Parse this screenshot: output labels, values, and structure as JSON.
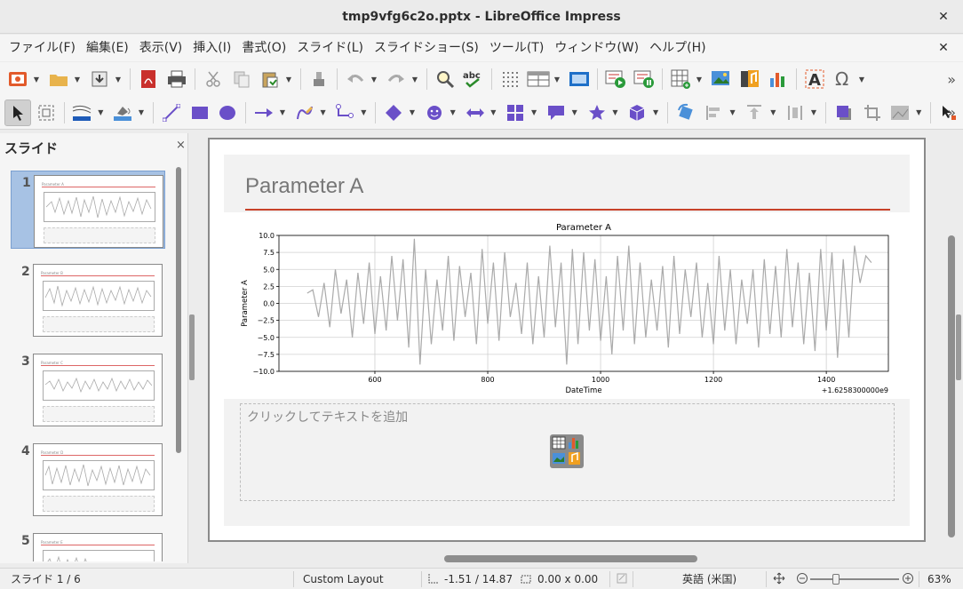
{
  "window": {
    "title": "tmp9vfg6c2o.pptx - LibreOffice Impress"
  },
  "menu": [
    "ファイル(F)",
    "編集(E)",
    "表示(V)",
    "挿入(I)",
    "書式(O)",
    "スライド(L)",
    "スライドショー(S)",
    "ツール(T)",
    "ウィンドウ(W)",
    "ヘルプ(H)"
  ],
  "slides_panel": {
    "title": "スライド",
    "close_label": "×",
    "thumbnails": [
      {
        "number": "1",
        "title": "Parameter A"
      },
      {
        "number": "2",
        "title": "Parameter B"
      },
      {
        "number": "3",
        "title": "Parameter C"
      },
      {
        "number": "4",
        "title": "Parameter D"
      },
      {
        "number": "5",
        "title": "Parameter E"
      }
    ]
  },
  "slide": {
    "title": "Parameter A",
    "text_placeholder": "クリックしてテキストを追加"
  },
  "chart_data": {
    "type": "line",
    "title": "Parameter A",
    "xlabel": "DateTime",
    "ylabel": "Parameter A",
    "offset_label": "+1.6258300000e9",
    "xlim": [
      430,
      1510
    ],
    "ylim": [
      -10.0,
      10.0
    ],
    "xticks": [
      600,
      800,
      1000,
      1200,
      1400
    ],
    "yticks": [
      "10.0",
      "7.5",
      "5.0",
      "2.5",
      "0.0",
      "−2.5",
      "−5.0",
      "−7.5",
      "−10.0"
    ],
    "grid": true,
    "color": "#aaaaaa",
    "series": [
      {
        "x": [
          480,
          490,
          500,
          510,
          520,
          530,
          540,
          550,
          560,
          570,
          580,
          590,
          600,
          610,
          620,
          630,
          640,
          650,
          660,
          670,
          680,
          690,
          700,
          710,
          720,
          730,
          740,
          750,
          760,
          770,
          780,
          790,
          800,
          810,
          820,
          830,
          840,
          850,
          860,
          870,
          880,
          890,
          900,
          910,
          920,
          930,
          940,
          950,
          960,
          970,
          980,
          990,
          1000,
          1010,
          1020,
          1030,
          1040,
          1050,
          1060,
          1070,
          1080,
          1090,
          1100,
          1110,
          1120,
          1130,
          1140,
          1150,
          1160,
          1170,
          1180,
          1190,
          1200,
          1210,
          1220,
          1230,
          1240,
          1250,
          1260,
          1270,
          1280,
          1290,
          1300,
          1310,
          1320,
          1330,
          1340,
          1350,
          1360,
          1370,
          1380,
          1390,
          1400,
          1410,
          1420,
          1430,
          1440,
          1450,
          1460,
          1470,
          1480
        ],
        "y": [
          1.5,
          2.0,
          -2.0,
          3.0,
          -3.5,
          5.0,
          -1.5,
          3.5,
          -5.0,
          4.5,
          -3.0,
          6.0,
          -4.5,
          4.0,
          -4.0,
          7.0,
          -2.5,
          6.5,
          -6.5,
          9.5,
          -9.0,
          5.0,
          -6.0,
          3.5,
          -4.0,
          7.0,
          -5.5,
          5.5,
          -2.0,
          4.5,
          -6.0,
          8.0,
          -3.0,
          6.0,
          -5.5,
          7.5,
          -2.0,
          3.0,
          -4.5,
          6.0,
          -6.0,
          4.0,
          -5.0,
          8.5,
          -3.5,
          6.0,
          -9.0,
          8.0,
          -6.0,
          7.5,
          -4.0,
          6.5,
          -5.5,
          4.0,
          -7.5,
          7.0,
          -4.0,
          8.5,
          -6.0,
          6.0,
          -5.0,
          3.5,
          -4.0,
          5.5,
          -6.5,
          7.0,
          -4.5,
          5.0,
          -2.0,
          6.0,
          -5.0,
          3.0,
          -6.0,
          7.0,
          -4.0,
          5.0,
          -6.0,
          3.5,
          -3.0,
          5.0,
          -6.5,
          6.5,
          -4.5,
          5.5,
          -5.0,
          8.0,
          -3.5,
          6.0,
          -6.0,
          4.5,
          -7.0,
          8.0,
          -4.0,
          7.5,
          -8.0,
          6.5,
          -5.0,
          8.5,
          3.0,
          7.0,
          6.0
        ]
      }
    ]
  },
  "statusbar": {
    "slide": "スライド 1 / 6",
    "layout": "Custom Layout",
    "position": "-1.51 / 14.87",
    "size": "0.00 x 0.00",
    "language": "英語 (米国)",
    "zoom": "63%"
  }
}
